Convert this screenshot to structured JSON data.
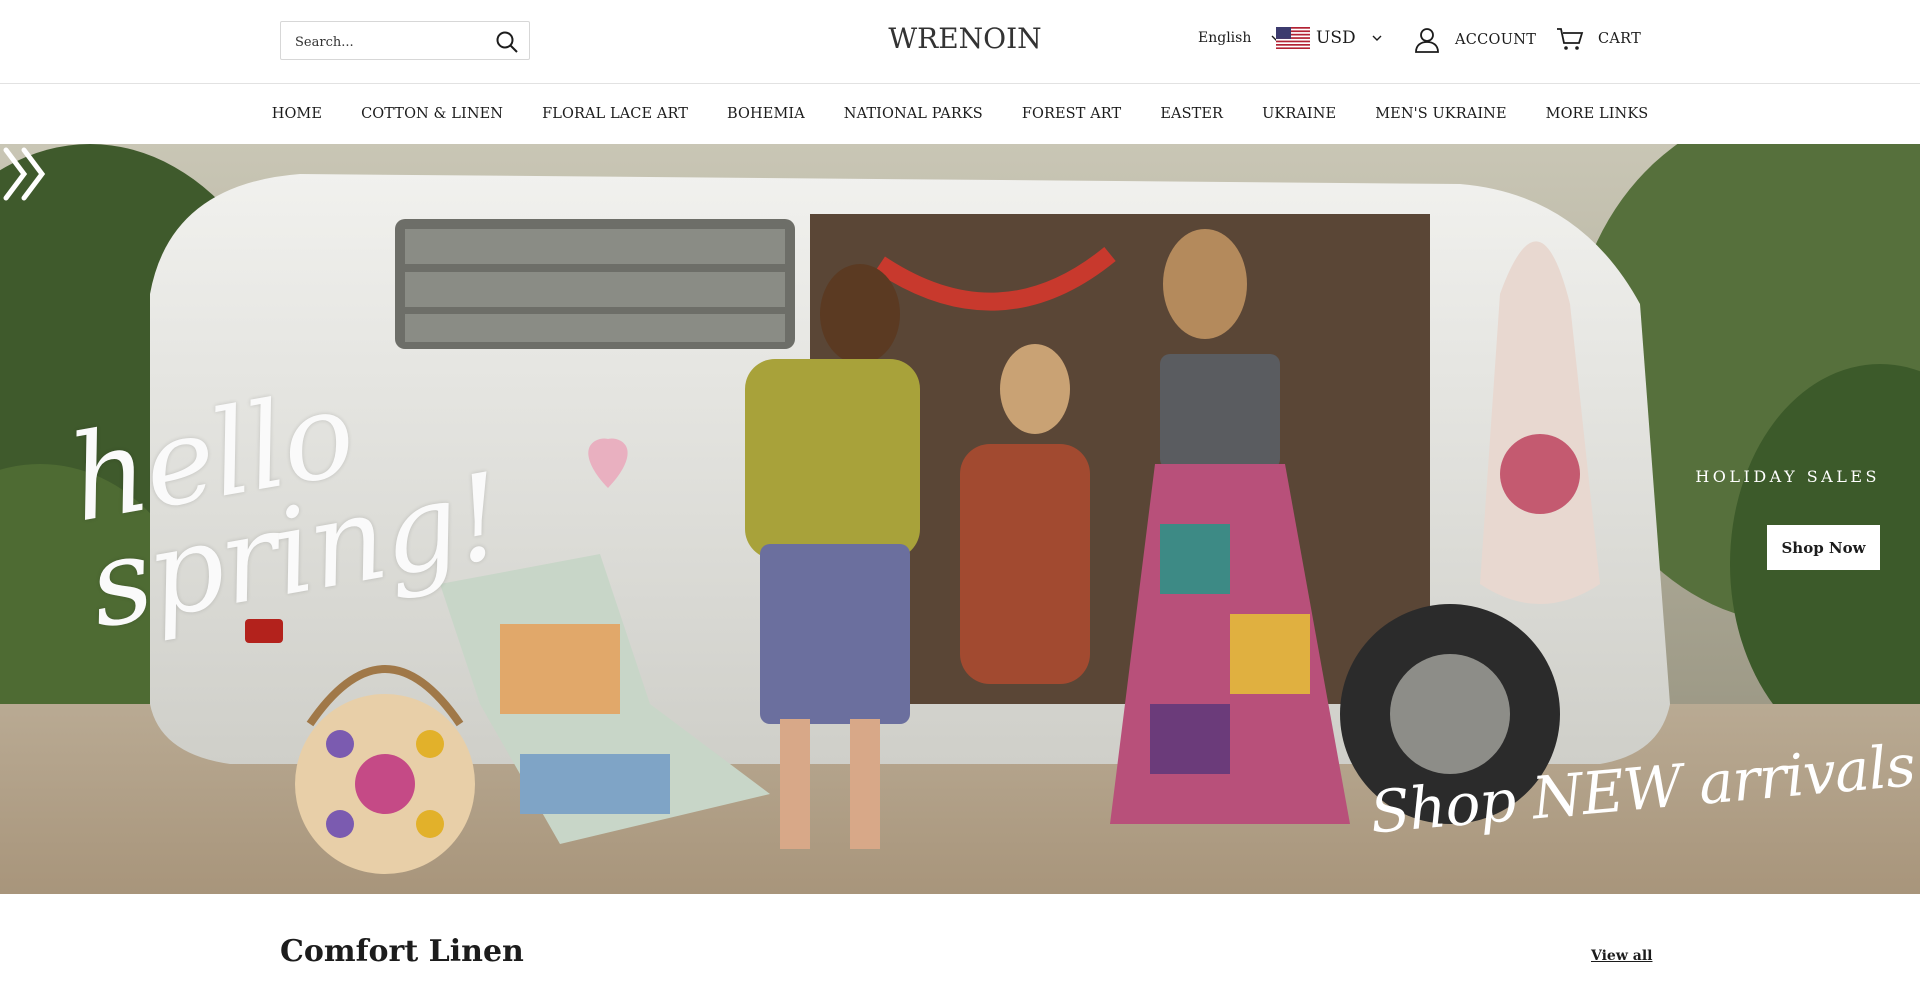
{
  "header": {
    "search": {
      "placeholder": "Search..."
    },
    "logo": "WRENOIN",
    "language": "English",
    "currency": "USD",
    "account_label": "ACCOUNT",
    "cart_label": "CART"
  },
  "nav": {
    "items": [
      "HOME",
      "COTTON & LINEN",
      "FLORAL LACE ART",
      "BOHEMIA",
      "NATIONAL PARKS",
      "FOREST ART",
      "EASTER",
      "UKRAINE",
      "MEN'S UKRAINE",
      "MORE LINKS"
    ]
  },
  "hero": {
    "script_text": "hello spring!",
    "eyebrow": "HOLIDAY SALES",
    "cta_label": "Shop Now",
    "tagline": "Shop NEW arrivals"
  },
  "section": {
    "title": "Comfort Linen",
    "view_all": "View all"
  },
  "colors": {
    "text": "#1c1c1c",
    "border": "#e2e2e2",
    "cta_bg": "#ffffff"
  }
}
